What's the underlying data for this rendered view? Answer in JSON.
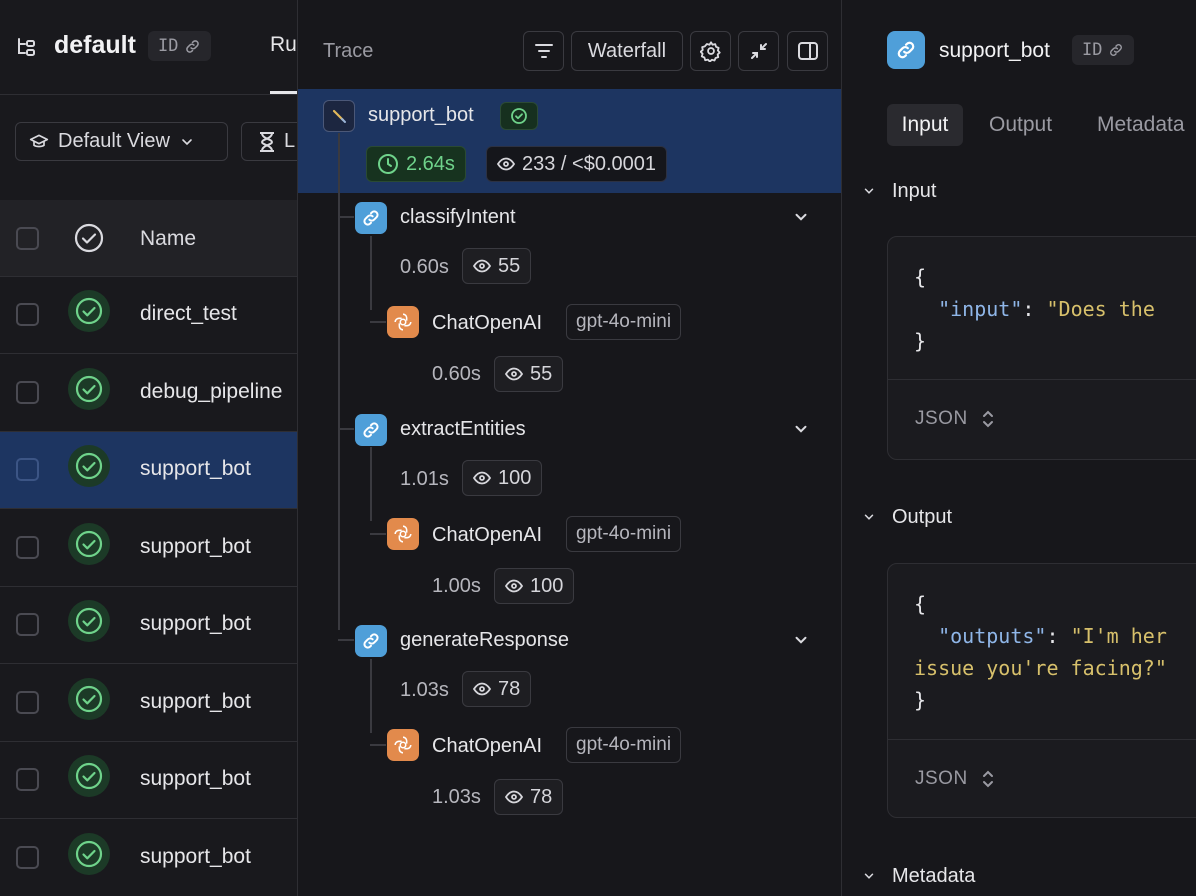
{
  "left": {
    "project_name": "default",
    "id_label": "ID",
    "tab_runs": "Runs",
    "view_label": "Default View",
    "filter_label": "L",
    "column_name": "Name",
    "rows": [
      {
        "name": "direct_test",
        "selected": false
      },
      {
        "name": "debug_pipeline",
        "selected": false
      },
      {
        "name": "support_bot",
        "selected": true
      },
      {
        "name": "support_bot",
        "selected": false
      },
      {
        "name": "support_bot",
        "selected": false
      },
      {
        "name": "support_bot",
        "selected": false
      },
      {
        "name": "support_bot",
        "selected": false
      },
      {
        "name": "support_bot",
        "selected": false
      }
    ]
  },
  "trace": {
    "label": "Trace",
    "waterfall_label": "Waterfall",
    "root": {
      "name": "support_bot",
      "latency": "2.64s",
      "tokens_cost": "233 / <$0.0001"
    },
    "nodes": [
      {
        "name": "classifyIntent",
        "latency": "0.60s",
        "tokens": "55",
        "child": {
          "name": "ChatOpenAI",
          "model": "gpt-4o-mini",
          "latency": "0.60s",
          "tokens": "55"
        }
      },
      {
        "name": "extractEntities",
        "latency": "1.01s",
        "tokens": "100",
        "child": {
          "name": "ChatOpenAI",
          "model": "gpt-4o-mini",
          "latency": "1.00s",
          "tokens": "100"
        }
      },
      {
        "name": "generateResponse",
        "latency": "1.03s",
        "tokens": "78",
        "child": {
          "name": "ChatOpenAI",
          "model": "gpt-4o-mini",
          "latency": "1.03s",
          "tokens": "78"
        }
      }
    ]
  },
  "detail": {
    "title": "support_bot",
    "id_label": "ID",
    "tabs": [
      "Input",
      "Output",
      "Metadata"
    ],
    "input_section": "Input",
    "output_section": "Output",
    "metadata_section": "Metadata",
    "format_label": "JSON",
    "input_code": {
      "open": "{",
      "key": "\"input\"",
      "colon": ": ",
      "value": "\"Does the",
      "close": "}"
    },
    "output_code": {
      "open": "{",
      "key": "\"outputs\"",
      "colon": ": ",
      "value": "\"I'm her",
      "cont": "issue you're facing?\"",
      "close": "}"
    }
  },
  "colors": {
    "selected_row": "#1d3561",
    "success_green": "#6fd38b",
    "chain_blue": "#4f9fd9",
    "openai_orange": "#e28a4c"
  }
}
